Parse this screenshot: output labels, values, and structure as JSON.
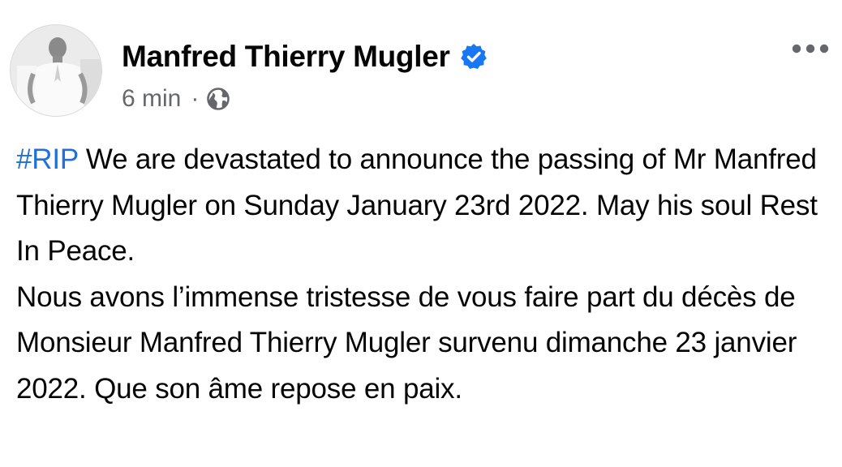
{
  "post": {
    "author": {
      "name": "Manfred Thierry Mugler",
      "avatar_icon": "profile-photo",
      "verified_icon": "verified-badge-icon",
      "verified_color": "#1877f2"
    },
    "timestamp": "6 min",
    "separator": "·",
    "privacy_icon": "globe-icon",
    "more_icon": "more-options-icon",
    "body": {
      "hashtag": "#RIP",
      "english_text": " We are devastated to announce the passing of Mr Manfred Thierry Mugler on Sunday January 23rd 2022. May his soul Rest In Peace.",
      "french_text": "Nous avons l’immense tristesse de vous faire part du décès de Monsieur Manfred Thierry Mugler survenu dimanche 23 janvier 2022. Que son âme repose en paix."
    }
  },
  "colors": {
    "hashtag": "#216fdb",
    "text": "#050505",
    "secondary_text": "#65676b"
  }
}
